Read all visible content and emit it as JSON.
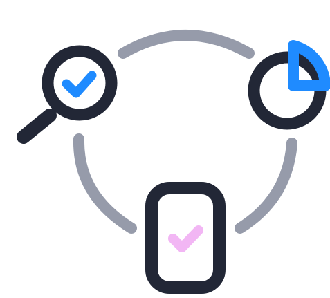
{
  "colors": {
    "background": "#ffffff",
    "outline": "#222736",
    "connector": "#969baa",
    "accent_blue": "#1f8bff",
    "accent_pink": "#f2b6f4"
  },
  "icons": {
    "search": "magnifier-with-checkmark-icon",
    "chart": "pie-chart-icon",
    "phone": "phone-with-checkmark-icon"
  }
}
